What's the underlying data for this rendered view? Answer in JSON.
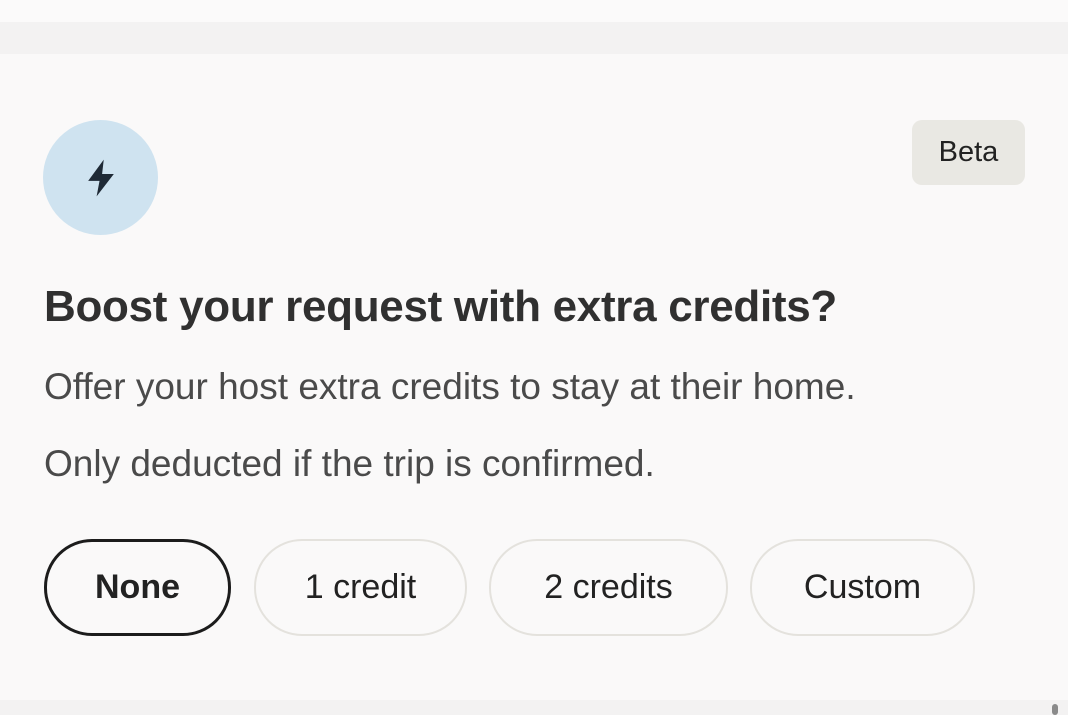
{
  "badge": {
    "label": "Beta"
  },
  "icon": {
    "name": "lightning-bolt-icon",
    "background_color": "#cfe3f0",
    "color": "#1f2a36"
  },
  "boost": {
    "title": "Boost your request with extra credits?",
    "description_line1": "Offer your host extra credits to stay at their home.",
    "description_line2": "Only deducted if the trip is confirmed."
  },
  "options": {
    "selected": "None",
    "items": [
      {
        "label": "None",
        "selected": true
      },
      {
        "label": "1 credit",
        "selected": false
      },
      {
        "label": "2 credits",
        "selected": false
      },
      {
        "label": "Custom",
        "selected": false
      }
    ]
  }
}
